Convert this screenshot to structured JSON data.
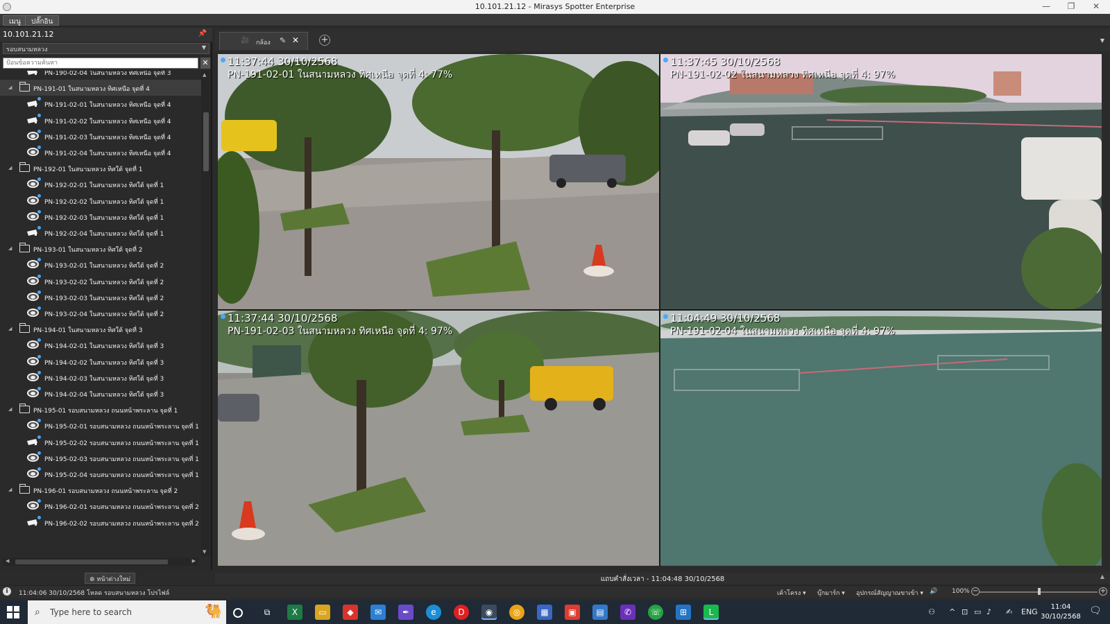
{
  "window": {
    "title": "10.101.21.12 - Mirasys Spotter Enterprise"
  },
  "menubar": {
    "menu": "เมนู",
    "plugins": "ปลั๊กอิน"
  },
  "left_panel": {
    "host": "10.101.21.12",
    "group_select": "รอบสนามหลวง",
    "search_placeholder": "ป้อนข้อความค้นหา",
    "add_page": "หน้าต่างใหม่",
    "tree": [
      {
        "type": "camera",
        "kind": "ptz",
        "label": "PN-190-02-04 ในสนามหลวง ทิศเหนือ จุดที่ 3",
        "selected": false
      },
      {
        "type": "folder",
        "label": "PN-191-01 ในสนามหลวง ทิศเหนือ จุดที่ 4",
        "selected": true
      },
      {
        "type": "camera",
        "kind": "ptz",
        "label": "PN-191-02-01 ในสนามหลวง ทิศเหนือ จุดที่ 4"
      },
      {
        "type": "camera",
        "kind": "ptz",
        "label": "PN-191-02-02 ในสนามหลวง ทิศเหนือ จุดที่ 4"
      },
      {
        "type": "camera",
        "kind": "dome",
        "label": "PN-191-02-03 ในสนามหลวง ทิศเหนือ จุดที่ 4"
      },
      {
        "type": "camera",
        "kind": "dome",
        "label": "PN-191-02-04 ในสนามหลวง ทิศเหนือ จุดที่ 4"
      },
      {
        "type": "folder",
        "label": "PN-192-01 ในสนามหลวง ทิศใต้ จุดที่ 1"
      },
      {
        "type": "camera",
        "kind": "dome",
        "label": "PN-192-02-01 ในสนามหลวง ทิศใต้ จุดที่ 1"
      },
      {
        "type": "camera",
        "kind": "dome",
        "label": "PN-192-02-02 ในสนามหลวง ทิศใต้ จุดที่ 1"
      },
      {
        "type": "camera",
        "kind": "dome",
        "label": "PN-192-02-03 ในสนามหลวง ทิศใต้ จุดที่ 1"
      },
      {
        "type": "camera",
        "kind": "ptz",
        "label": "PN-192-02-04 ในสนามหลวง ทิศใต้ จุดที่ 1"
      },
      {
        "type": "folder",
        "label": "PN-193-01 ในสนามหลวง ทิศใต้ จุดที่ 2"
      },
      {
        "type": "camera",
        "kind": "dome",
        "label": "PN-193-02-01 ในสนามหลวง ทิศใต้ จุดที่ 2"
      },
      {
        "type": "camera",
        "kind": "dome",
        "label": "PN-193-02-02 ในสนามหลวง ทิศใต้ จุดที่ 2"
      },
      {
        "type": "camera",
        "kind": "dome",
        "label": "PN-193-02-03 ในสนามหลวง ทิศใต้ จุดที่ 2"
      },
      {
        "type": "camera",
        "kind": "dome",
        "label": "PN-193-02-04 ในสนามหลวง ทิศใต้ จุดที่ 2"
      },
      {
        "type": "folder",
        "label": "PN-194-01 ในสนามหลวง ทิศใต้ จุดที่ 3"
      },
      {
        "type": "camera",
        "kind": "dome",
        "label": "PN-194-02-01 ในสนามหลวง ทิศใต้ จุดที่ 3"
      },
      {
        "type": "camera",
        "kind": "dome",
        "label": "PN-194-02-02 ในสนามหลวง ทิศใต้ จุดที่ 3"
      },
      {
        "type": "camera",
        "kind": "dome",
        "label": "PN-194-02-03 ในสนามหลวง ทิศใต้ จุดที่ 3"
      },
      {
        "type": "camera",
        "kind": "dome",
        "label": "PN-194-02-04 ในสนามหลวง ทิศใต้ จุดที่ 3"
      },
      {
        "type": "folder",
        "label": "PN-195-01 รอบสนามหลวง ถนนหน้าพระลาน จุดที่ 1"
      },
      {
        "type": "camera",
        "kind": "dome",
        "label": "PN-195-02-01 รอบสนามหลวง ถนนหน้าพระลาน จุดที่ 1"
      },
      {
        "type": "camera",
        "kind": "ptz",
        "label": "PN-195-02-02 รอบสนามหลวง ถนนหน้าพระลาน จุดที่ 1"
      },
      {
        "type": "camera",
        "kind": "dome",
        "label": "PN-195-02-03 รอบสนามหลวง ถนนหน้าพระลาน จุดที่ 1"
      },
      {
        "type": "camera",
        "kind": "dome",
        "label": "PN-195-02-04 รอบสนามหลวง ถนนหน้าพระลาน จุดที่ 1"
      },
      {
        "type": "folder",
        "label": "PN-196-01 รอบสนามหลวง ถนนหน้าพระลาน จุดที่ 2"
      },
      {
        "type": "camera",
        "kind": "dome",
        "label": "PN-196-02-01 รอบสนามหลวง ถนนหน้าพระลาน จุดที่ 2"
      },
      {
        "type": "camera",
        "kind": "ptz",
        "label": "PN-196-02-02 รอบสนามหลวง ถนนหน้าพระลาน จุดที่ 2"
      }
    ]
  },
  "tabs": {
    "camera_tab": "กล้อง"
  },
  "cameras": [
    {
      "timestamp": "11:37:44  30/10/2568",
      "caption": "PN-191-02-01 ในสนามหลวง ทิศเหนือ จุดที่ 4: 77%"
    },
    {
      "timestamp": "11:37:45  30/10/2568",
      "caption": "PN-191-02-02 ในสนามหลวง ทิศเหนือ จุดที่ 4: 97%"
    },
    {
      "timestamp": "11:37:44  30/10/2568",
      "caption": "PN-191-02-03 ในสนามหลวง ทิศเหนือ จุดที่ 4: 97%"
    },
    {
      "timestamp": "11:04:49  30/10/2568",
      "caption": "PN-191-02-04 ในสนามหลวง ทิศเหนือ จุดที่ 4: 97%"
    }
  ],
  "status": {
    "time_bar": "แถบคำสั่งเวลา - 11:04:48 30/10/2568",
    "message": "11:04:06  30/10/2568 โหลด รอบสนามหลวง โปรไฟล์",
    "btn_layout": "เค้าโครง",
    "btn_bookmark": "บุ๊กมาร์ก",
    "btn_devices": "อุปกรณ์สัญญาณขาเข้า",
    "zoom": "100%"
  },
  "taskbar": {
    "search_placeholder": "Type here to search",
    "lang": "ENG",
    "time": "11:04",
    "date": "30/10/2568"
  }
}
